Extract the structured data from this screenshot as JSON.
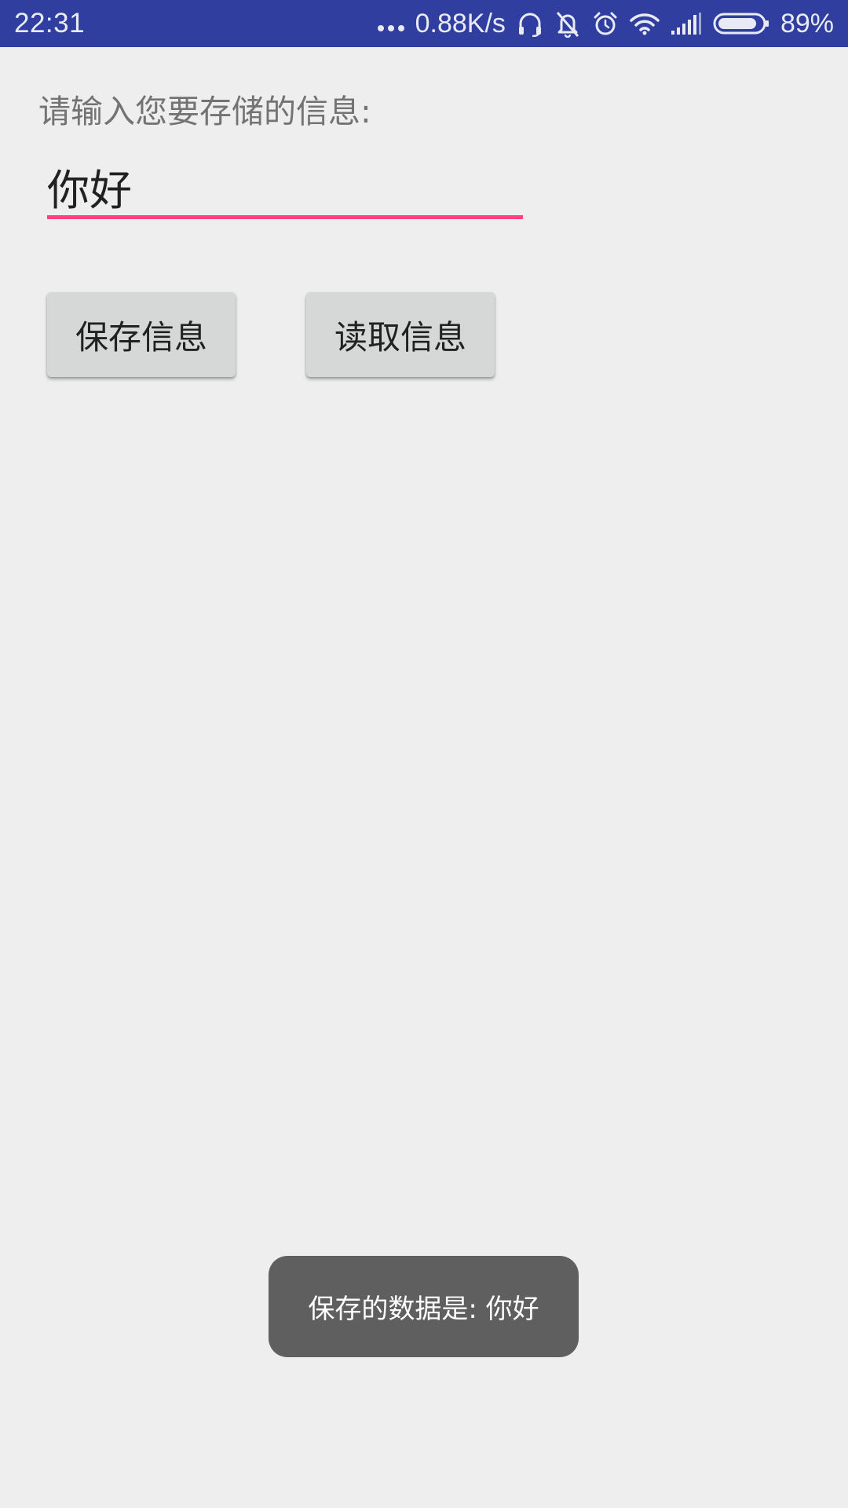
{
  "status_bar": {
    "time": "22:31",
    "network_speed": "0.88K/s",
    "battery_percent": "89%",
    "battery_level": 0.89,
    "icons": [
      "more-dots-icon",
      "headset-icon",
      "notifications-off-icon",
      "alarm-icon",
      "wifi-icon",
      "signal-icon",
      "battery-icon"
    ]
  },
  "main": {
    "prompt_label": "请输入您要存储的信息:",
    "input_value": "你好",
    "save_button_label": "保存信息",
    "read_button_label": "读取信息"
  },
  "toast": {
    "message": "保存的数据是: 你好"
  },
  "colors": {
    "status_bar": "#303f9f",
    "accent": "#ff4081",
    "background": "#eeeeee",
    "button": "#d6d7d7",
    "toast": "#5f5f5f"
  }
}
